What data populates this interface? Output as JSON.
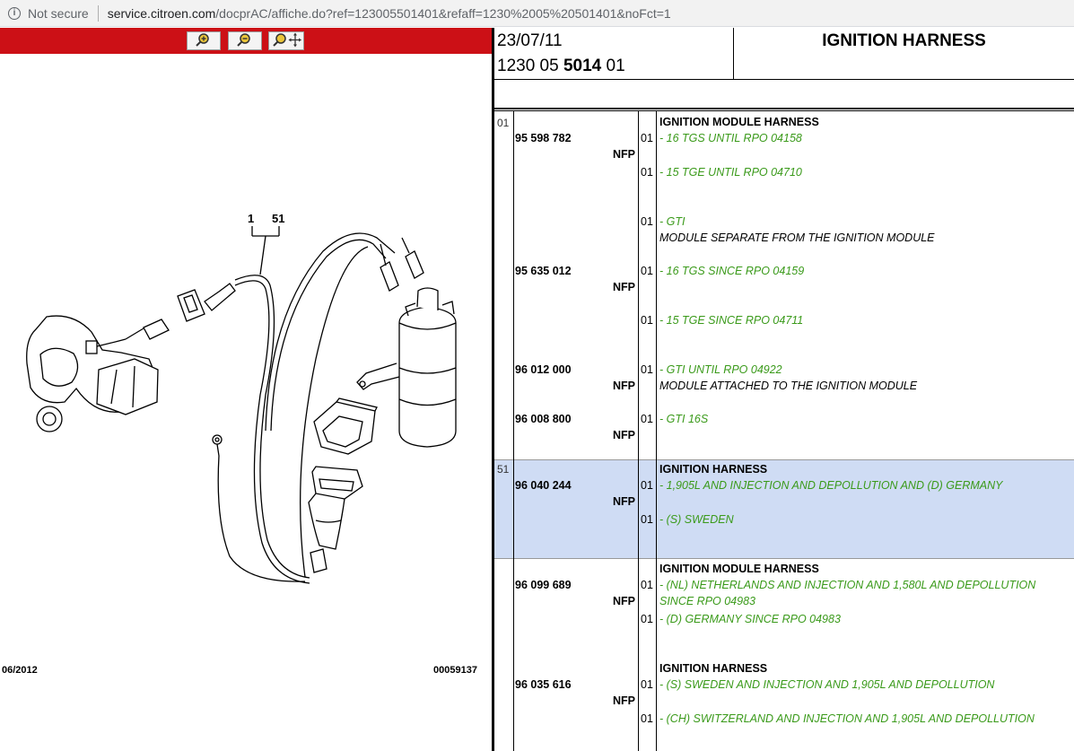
{
  "browser": {
    "security": "Not secure",
    "host": "service.citroen.com",
    "path": "/docprAC/affiche.do?ref=123005501401&refaff=1230%2005%20501401&noFct=1"
  },
  "toolbar": {
    "zoom_in": "🔍+",
    "zoom_out": "🔍−",
    "zoom_pan": "🔍✥"
  },
  "diagram": {
    "callout_left": "1",
    "callout_right": "51",
    "date": "06/2012",
    "figure_no": "00059137"
  },
  "header": {
    "date": "23/07/11",
    "ref_prefix": "1230 05 ",
    "ref_bold": "5014",
    "ref_suffix": " 01",
    "title": "IGNITION HARNESS"
  },
  "rows": [
    {
      "ref": "01",
      "heading": "IGNITION MODULE HARNESS"
    },
    {
      "pn": "95 598 782",
      "nfp": "NFP",
      "q1": "01",
      "d1": "- 16 TGS UNTIL RPO 04158",
      "q2": "01",
      "d2": "- 15 TGE UNTIL RPO 04710"
    },
    {
      "q1": "01",
      "d1": "- GTI",
      "k1": "MODULE SEPARATE FROM THE IGNITION MODULE"
    },
    {
      "pn": "95 635 012",
      "nfp": "NFP",
      "q1": "01",
      "d1": "- 16 TGS SINCE RPO 04159",
      "q2": "01",
      "d2": "- 15 TGE SINCE RPO 04711"
    },
    {
      "pn": "96 012 000",
      "nfp": "NFP",
      "q1": "01",
      "d1": "- GTI UNTIL RPO 04922",
      "k1": "MODULE ATTACHED TO THE IGNITION MODULE"
    },
    {
      "pn": "96 008 800",
      "nfp": "NFP",
      "q1": "01",
      "d1": "- GTI 16S"
    },
    {
      "ref": "51",
      "heading": "IGNITION HARNESS",
      "pn": "96 040 244",
      "nfp": "NFP",
      "q1": "01",
      "d1": "- 1,905L AND INJECTION AND DEPOLLUTION AND (D) GERMANY",
      "q2": "01",
      "d2": "- (S) SWEDEN"
    },
    {
      "heading": "IGNITION MODULE HARNESS",
      "pn": "96 099 689",
      "nfp": "NFP",
      "q1": "01",
      "d1": "- (NL) NETHERLANDS AND INJECTION AND 1,580L AND DEPOLLUTION",
      "d1b": "SINCE RPO 04983",
      "q2": "01",
      "d2": "- (D) GERMANY SINCE RPO 04983"
    },
    {
      "heading": "IGNITION HARNESS",
      "pn": "96 035 616",
      "nfp": "NFP",
      "q1": "01",
      "d1": "- (S) SWEDEN AND INJECTION AND 1,905L AND DEPOLLUTION",
      "q2": "01",
      "d2": "- (CH) SWITZERLAND AND INJECTION AND 1,905L AND DEPOLLUTION"
    }
  ]
}
